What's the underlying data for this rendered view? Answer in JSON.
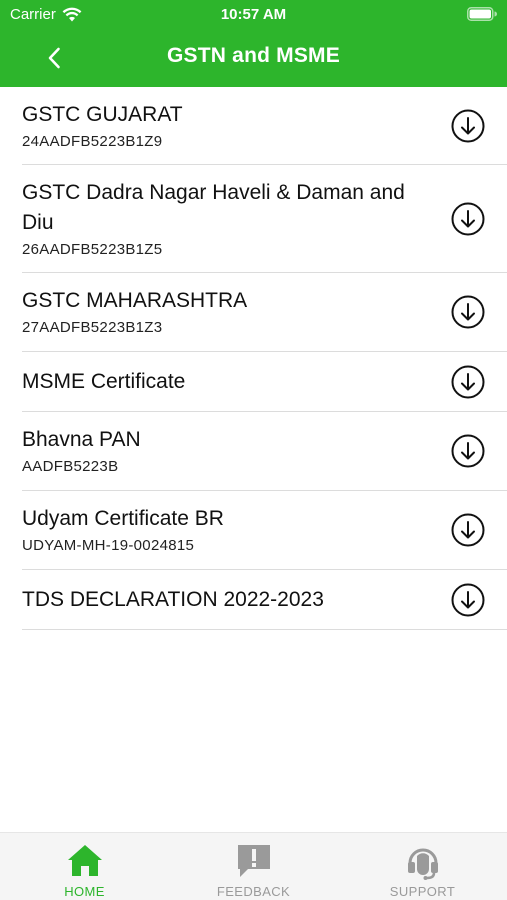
{
  "status_bar": {
    "carrier": "Carrier",
    "time": "10:57 AM"
  },
  "nav": {
    "title": "GSTN and MSME",
    "back_icon": "chevron-left-icon"
  },
  "colors": {
    "brand_green": "#2db52c",
    "tab_inactive": "#9a9a9a"
  },
  "documents": [
    {
      "title": "GSTC GUJARAT",
      "subtitle": "24AADFB5223B1Z9",
      "icon": "download-icon"
    },
    {
      "title": "GSTC Dadra Nagar Haveli & Daman and Diu",
      "subtitle": "26AADFB5223B1Z5",
      "icon": "download-icon"
    },
    {
      "title": "GSTC MAHARASHTRA",
      "subtitle": "27AADFB5223B1Z3",
      "icon": "download-icon"
    },
    {
      "title": "MSME Certificate",
      "subtitle": "",
      "icon": "download-icon"
    },
    {
      "title": "Bhavna PAN",
      "subtitle": "AADFB5223B",
      "icon": "download-icon"
    },
    {
      "title": "Udyam Certificate BR",
      "subtitle": "UDYAM-MH-19-0024815",
      "icon": "download-icon"
    },
    {
      "title": "TDS DECLARATION 2022-2023",
      "subtitle": "",
      "icon": "download-icon"
    }
  ],
  "tabs": [
    {
      "label": "HOME",
      "icon": "home-icon",
      "active": true
    },
    {
      "label": "FEEDBACK",
      "icon": "feedback-icon",
      "active": false
    },
    {
      "label": "SUPPORT",
      "icon": "headset-icon",
      "active": false
    }
  ]
}
